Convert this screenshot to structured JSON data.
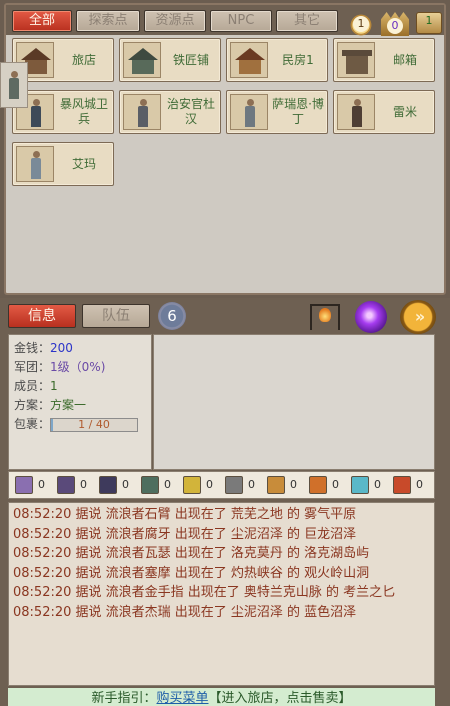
{
  "filter_tabs": [
    {
      "label": "全部",
      "active": true
    },
    {
      "label": "探索点",
      "active": false
    },
    {
      "label": "资源点",
      "active": false
    },
    {
      "label": "NPC",
      "active": false
    },
    {
      "label": "其它",
      "active": false
    }
  ],
  "resources": {
    "sun": "1",
    "crown": "0",
    "scroll": "1"
  },
  "locations": [
    {
      "label": "旅店",
      "kind": "building"
    },
    {
      "label": "铁匠铺",
      "kind": "building"
    },
    {
      "label": "民房1",
      "kind": "building"
    },
    {
      "label": "邮箱",
      "kind": "building"
    },
    {
      "label": "暴风城卫兵",
      "kind": "npc"
    },
    {
      "label": "治安官杜汉",
      "kind": "npc"
    },
    {
      "label": "萨瑞恩·博丁",
      "kind": "npc"
    },
    {
      "label": "雷米",
      "kind": "npc"
    },
    {
      "label": "艾玛",
      "kind": "npc"
    }
  ],
  "bottom_tabs": [
    {
      "label": "信息",
      "active": true
    },
    {
      "label": "队伍",
      "active": false
    }
  ],
  "team_count": "6",
  "info": {
    "gold_label": "金钱：",
    "gold": "200",
    "legion_label": "军团：",
    "legion": "1级（0%)",
    "members_label": "成员：",
    "members": "1",
    "plan_label": "方案：",
    "plan": "方案一",
    "bag_label": "包裹：",
    "bag": "1 / 40",
    "bag_fill": 0.025
  },
  "items": [
    {
      "count": "0",
      "color": "#8a6fb0"
    },
    {
      "count": "0",
      "color": "#5a4a7a"
    },
    {
      "count": "0",
      "color": "#3e3a5c"
    },
    {
      "count": "0",
      "color": "#4e6e5e"
    },
    {
      "count": "0",
      "color": "#d2b43a"
    },
    {
      "count": "0",
      "color": "#7a7a7a"
    },
    {
      "count": "0",
      "color": "#c88c3a"
    },
    {
      "count": "0",
      "color": "#d0702a"
    },
    {
      "count": "0",
      "color": "#5ab8c8"
    },
    {
      "count": "0",
      "color": "#c84a2a"
    }
  ],
  "log": [
    "08:52:20 据说 流浪者石臂 出现在了 荒芜之地 的 雾气平原",
    "08:52:20 据说 流浪者腐牙 出现在了 尘泥沼泽 的 巨龙沼泽",
    "08:52:20 据说 流浪者瓦瑟 出现在了 洛克莫丹 的 洛克湖岛屿",
    "08:52:20 据说 流浪者塞摩 出现在了 灼热峡谷 的 观火岭山洞",
    "08:52:20 据说 流浪者金手指 出现在了 奥特兰克山脉 的 考兰之匕",
    "08:52:20 据说 流浪者杰瑞 出现在了 尘泥沼泽 的 蓝色沼泽"
  ],
  "guide": {
    "prefix": "新手指引：",
    "link": "购买菜单",
    "suffix": "【进入旅店，点击售卖】"
  }
}
